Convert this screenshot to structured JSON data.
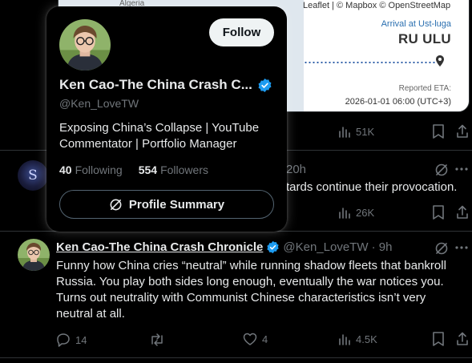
{
  "map_card": {
    "map_label": "Algeria",
    "attribution": "Leaflet | © Mapbox © OpenStreetMap",
    "arrival_label": "Arrival at Ust-luga",
    "port_code": "RU ULU",
    "eta_label": "Reported ETA:",
    "eta_value": "2026-01-01 06:00 (UTC+3)"
  },
  "post1": {
    "views": "51K"
  },
  "post2": {
    "time": "20h",
    "text_visible": "tards continue their provocation.",
    "views": "26K"
  },
  "post3": {
    "author_name": "Ken Cao-The China Crash Chronicle",
    "handle_time": "@Ken_LoveTW · 9h",
    "text": "Funny how China cries “neutral” while running shadow fleets that bankroll Russia. You play both sides long enough, eventually the war notices you. Turns out neutrality with Communist Chinese characteristics isn’t very neutral at all.",
    "replies": "14",
    "likes": "4",
    "views": "4.5K"
  },
  "hover_card": {
    "follow_label": "Follow",
    "display_name": "Ken Cao-The China Crash C...",
    "handle": "@Ken_LoveTW",
    "bio": "Exposing China’s Collapse | YouTube Commentator | Portfolio Manager",
    "following_count": "40",
    "following_label": "Following",
    "followers_count": "554",
    "followers_label": "Followers",
    "summary_label": "Profile Summary"
  },
  "icons": [
    "verified-badge-icon",
    "grok-icon",
    "more-icon",
    "views-icon",
    "bookmark-icon",
    "share-icon",
    "reply-icon",
    "repost-icon",
    "like-icon",
    "location-pin-icon"
  ],
  "colors": {
    "background": "#000000",
    "text": "#e7e9ea",
    "muted": "#71767b",
    "verified": "#1d9bf0",
    "divider": "#2f3336"
  }
}
